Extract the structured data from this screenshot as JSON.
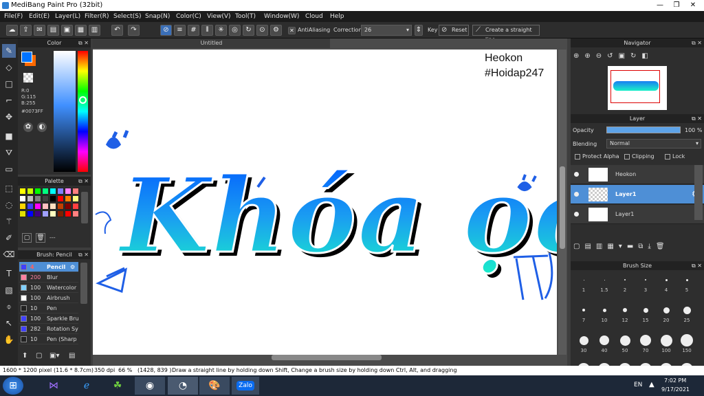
{
  "window": {
    "title": "MediBang Paint Pro (32bit)",
    "min": "—",
    "max": "❐",
    "close": "✕"
  },
  "menu": [
    "File(F)",
    "Edit(E)",
    "Layer(L)",
    "Filter(R)",
    "Select(S)",
    "Snap(N)",
    "Color(C)",
    "View(V)",
    "Tool(T)",
    "Window(W)",
    "Cloud",
    "Help"
  ],
  "toolbar": {
    "antialiasing_label": "AntiAliasing",
    "correction_label": "Correction",
    "correction_value": "26",
    "key_label": "Key",
    "reset_label": "Reset",
    "straight_line_label": "Create a straight line"
  },
  "canvas": {
    "doc_title": "Untitled",
    "artwork_text": "Khóa ọc",
    "note_line1": "Heokon",
    "note_line2": "#Hoidap247"
  },
  "color_panel": {
    "title": "Color",
    "r": "R:0",
    "g": "G:115",
    "b": "B:255",
    "hex": "#0073FF",
    "primary": "#0073ff",
    "secondary": "#ff6a00"
  },
  "palette_panel": {
    "title": "Palette",
    "field": "---",
    "swatches": [
      "#ffff00",
      "#c8ff00",
      "#00ff00",
      "#00ff80",
      "#00ffff",
      "#8080ff",
      "#ff80ff",
      "#ff8080",
      "#ffffff",
      "#c0c0c0",
      "#808080",
      "#404040",
      "#000000",
      "#ff0000",
      "#ff8000",
      "#ffff80",
      "#ffd700",
      "#4040ff",
      "#ff00ff",
      "#ffc0c0",
      "#ffe0c0",
      "#c04000",
      "#800000",
      "#ff4040",
      "#e0e000",
      "#0000ff",
      "#400080",
      "#a0a0ff",
      "#ffffc0",
      "#802000",
      "#ff0000",
      "#ff8080"
    ]
  },
  "brush_panel": {
    "title": "Brush: Pencil",
    "items": [
      {
        "size": "4",
        "name": "Pencil",
        "color": "#4040ff"
      },
      {
        "size": "200",
        "name": "Blur",
        "color": "#ff80a0"
      },
      {
        "size": "100",
        "name": "Watercolor",
        "color": "#80d0ff"
      },
      {
        "size": "100",
        "name": "Airbrush",
        "color": "#ffffff"
      },
      {
        "size": "10",
        "name": "Pen",
        "color": "#222222"
      },
      {
        "size": "100",
        "name": "Sparkle Bru",
        "color": "#4040ff"
      },
      {
        "size": "282",
        "name": "Rotation Sy",
        "color": "#4040ff"
      },
      {
        "size": "10",
        "name": "Pen (Sharp",
        "color": "#222222"
      }
    ]
  },
  "navigator": {
    "title": "Navigator"
  },
  "layer_panel": {
    "title": "Layer",
    "opacity_label": "Opacity",
    "opacity_value": "100 %",
    "blending_label": "Blending",
    "blending_value": "Normal",
    "protect_alpha": "Protect Alpha",
    "clipping": "Clipping",
    "lock": "Lock",
    "layers": [
      {
        "name": "Heokon",
        "selected": false
      },
      {
        "name": "Layer1",
        "selected": true
      },
      {
        "name": "Layer1",
        "selected": false
      }
    ]
  },
  "brush_size_panel": {
    "title": "Brush Size",
    "sizes": [
      [
        "1",
        "1.5",
        "2",
        "3",
        "4",
        "5"
      ],
      [
        "7",
        "10",
        "12",
        "15",
        "20",
        "25"
      ],
      [
        "30",
        "40",
        "50",
        "70",
        "100",
        "150"
      ]
    ]
  },
  "status": {
    "pixels": "1600 * 1200 pixel",
    "cm": "(11.6 * 8.7cm)",
    "dpi": "350 dpi",
    "zoom": "66 %",
    "coords": "(1428, 839 )",
    "hint": "Draw a straight line by holding down Shift, Change a brush size by holding down Ctrl, Alt, and dragging"
  },
  "taskbar": {
    "lang": "EN",
    "time": "7:02 PM",
    "date": "9/17/2021",
    "zalo": "Zalo"
  }
}
